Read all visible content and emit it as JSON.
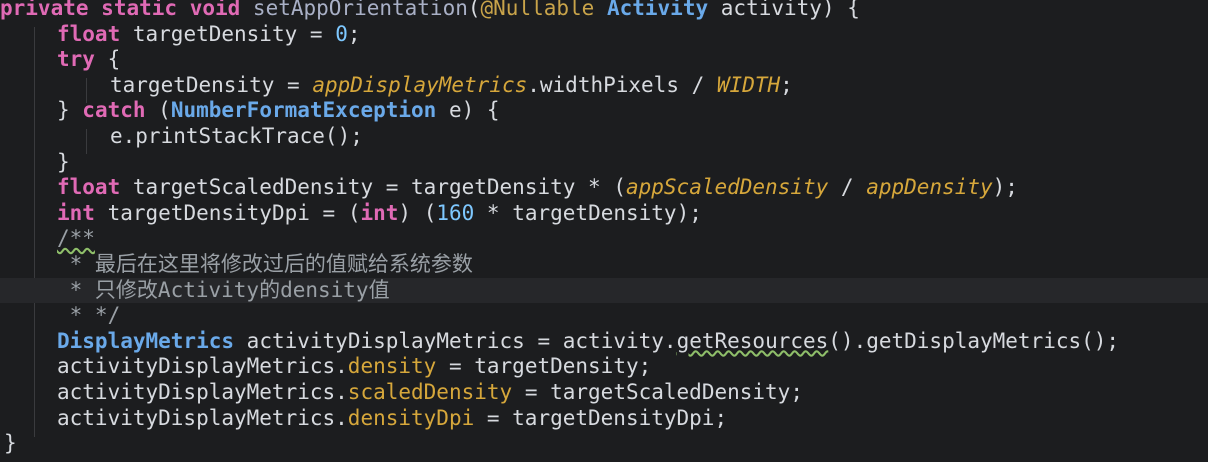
{
  "code": {
    "line01": {
      "kw1": "private",
      "kw2": "static",
      "kw3": "void",
      "name": "setAppOrientation",
      "open_paren": "(",
      "annotation": "@Nullable",
      "type": "Activity",
      "param": "activity",
      "close": ") {"
    },
    "line02": {
      "kw": "float",
      "var": "targetDensity",
      "eq": " = ",
      "num": "0",
      "end": ";"
    },
    "line03": {
      "kw": "try",
      "rest": " {"
    },
    "line04": {
      "var": "targetDensity",
      "eq": " = ",
      "static1": "appDisplayMetrics",
      "dot": ".widthPixels",
      "op": " / ",
      "static2": "WIDTH",
      "end": ";"
    },
    "line05": {
      "open": "} ",
      "kw": "catch",
      "paren": " (",
      "type": "NumberFormatException",
      "rest": " e) {"
    },
    "line06": {
      "text": "e.printStackTrace();"
    },
    "line07": {
      "text": "}"
    },
    "line08": {
      "kw": "float",
      "var": "targetScaledDensity",
      "eq": " = ",
      "rhs1": "targetDensity",
      "op": " * (",
      "static1": "appScaledDensity",
      "div": " / ",
      "static2": "appDensity",
      "end": ");"
    },
    "line09": {
      "kw": "int",
      "var": "targetDensityDpi",
      "eq": " = (",
      "cast": "int",
      "mid": ") (",
      "num": "160",
      "op": " * ",
      "rhs": "targetDensity",
      "end": ");"
    },
    "line10": {
      "text": "/**"
    },
    "line11": {
      "text": " * 最后在这里将修改过后的值赋给系统参数"
    },
    "line12": {
      "text": " * 只修改Activity的density值"
    },
    "line13": {
      "text": " * */"
    },
    "line14": {
      "type": "DisplayMetrics",
      "var": "activityDisplayMetrics",
      "eq": " = ",
      "obj": "activity.",
      "method": "getResources",
      "rest": "().getDisplayMetrics();"
    },
    "line15": {
      "obj": "activityDisplayMetrics.",
      "field": "density",
      "rest": " = targetDensity;"
    },
    "line16": {
      "obj": "activityDisplayMetrics.",
      "field": "scaledDensity",
      "rest": " = targetScaledDensity;"
    },
    "line17": {
      "obj": "activityDisplayMetrics.",
      "field": "densityDpi",
      "rest": " = targetDensityDpi;"
    },
    "line18": {
      "text": "}"
    }
  }
}
